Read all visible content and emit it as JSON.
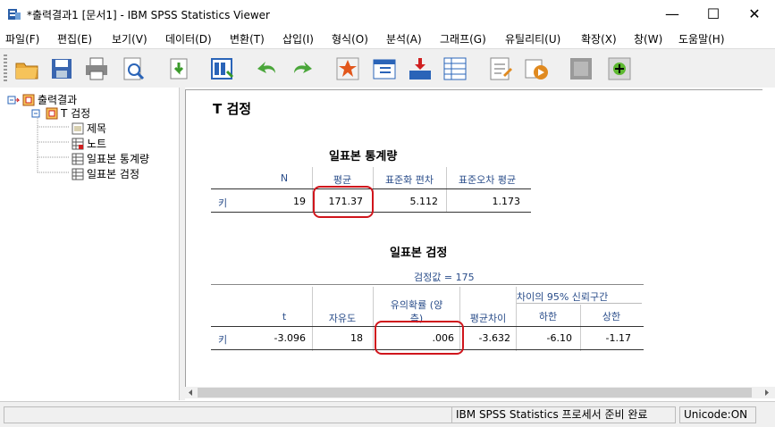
{
  "window": {
    "title": "*출력결과1 [문서1] - IBM SPSS Statistics Viewer",
    "minimize": "—",
    "maximize": "☐",
    "close": "✕"
  },
  "menu": [
    "파일(F)",
    "편집(E)",
    "보기(V)",
    "데이터(D)",
    "변환(T)",
    "삽입(I)",
    "형식(O)",
    "분석(A)",
    "그래프(G)",
    "유틸리티(U)",
    "확장(X)",
    "창(W)",
    "도움말(H)"
  ],
  "toolbar_icons": [
    "open-icon",
    "save-icon",
    "print-icon",
    "print-preview-icon",
    "export-icon",
    "data-editor-icon",
    "undo-icon",
    "redo-icon",
    "goto-data-icon",
    "goto-case-icon",
    "goto-variable-icon",
    "variables-icon",
    "designate-window-icon",
    "run-script-icon",
    "insert-output-icon",
    "collapse-icon",
    "expand-icon"
  ],
  "tree": {
    "root": "출력결과",
    "group": "T 검정",
    "items": [
      "제목",
      "노트",
      "일표본 통계량",
      "일표본 검정"
    ]
  },
  "output": {
    "heading": "T 검정",
    "stats": {
      "title": "일표본 통계량",
      "headers": [
        "N",
        "평균",
        "표준화 편차",
        "표준오차 평균"
      ],
      "row_label": "키",
      "values": [
        "19",
        "171.37",
        "5.112",
        "1.173"
      ]
    },
    "test": {
      "title": "일표본 검정",
      "subtitle": "검정값 = 175",
      "ci_header": "차이의 95% 신뢰구간",
      "headers": [
        "t",
        "자유도",
        "유의확률 (양측)",
        "평균차이",
        "하한",
        "상한"
      ],
      "sig_line1": "유의확률 (양",
      "sig_line2": "측)",
      "row_label": "키",
      "values": [
        "-3.096",
        "18",
        ".006",
        "-3.632",
        "-6.10",
        "-1.17"
      ]
    }
  },
  "status": {
    "processor": "IBM SPSS Statistics 프로세서 준비 완료",
    "unicode": "Unicode:ON"
  },
  "colors": {
    "highlight": "#d0151c",
    "header_text": "#2a4d8a"
  }
}
